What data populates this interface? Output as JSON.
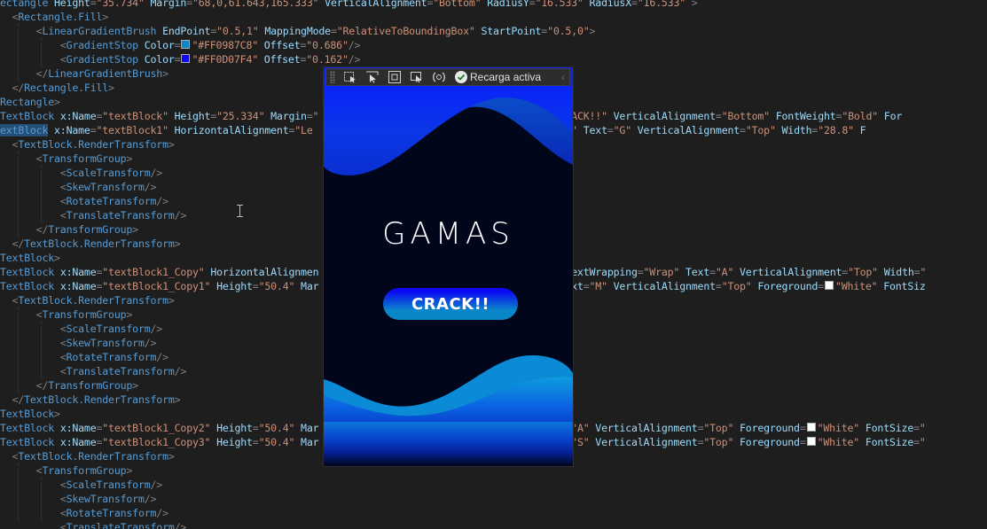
{
  "editor": {
    "lines": [
      [
        [
          "el",
          "ectangle "
        ],
        [
          "at",
          "Height"
        ],
        [
          "br",
          "="
        ],
        [
          "st",
          "\"35.734\""
        ],
        [
          "at",
          " Margin"
        ],
        [
          "br",
          "="
        ],
        [
          "st",
          "\"68,0,61.643,165.333\""
        ],
        [
          "at",
          " VerticalAlignment"
        ],
        [
          "br",
          "="
        ],
        [
          "st",
          "\"Bottom\""
        ],
        [
          "at",
          " RadiusY"
        ],
        [
          "br",
          "="
        ],
        [
          "st",
          "\"16.533\""
        ],
        [
          "at",
          " RadiusX"
        ],
        [
          "br",
          "="
        ],
        [
          "st",
          "\"16.533\""
        ],
        [
          "br",
          " >"
        ]
      ],
      [
        [
          "tx",
          "  "
        ],
        [
          "br",
          "<"
        ],
        [
          "el",
          "Rectangle.Fill"
        ],
        [
          "br",
          ">"
        ]
      ],
      [
        [
          "tx",
          "      "
        ],
        [
          "br",
          "<"
        ],
        [
          "el",
          "LinearGradientBrush"
        ],
        [
          "at",
          " EndPoint"
        ],
        [
          "br",
          "="
        ],
        [
          "st",
          "\"0.5,1\""
        ],
        [
          "at",
          " MappingMode"
        ],
        [
          "br",
          "="
        ],
        [
          "st",
          "\"RelativeToBoundingBox\""
        ],
        [
          "at",
          " StartPoint"
        ],
        [
          "br",
          "="
        ],
        [
          "st",
          "\"0.5,0\""
        ],
        [
          "br",
          ">"
        ]
      ],
      [
        [
          "tx",
          "          "
        ],
        [
          "br",
          "<"
        ],
        [
          "el",
          "GradientStop"
        ],
        [
          "at",
          " Color"
        ],
        [
          "br",
          "="
        ],
        [
          "sw",
          "#0987c8"
        ],
        [
          "st",
          "\"#FF0987C8\""
        ],
        [
          "at",
          " Offset"
        ],
        [
          "br",
          "="
        ],
        [
          "st",
          "\"0.686\""
        ],
        [
          "br",
          "/>"
        ]
      ],
      [
        [
          "tx",
          "          "
        ],
        [
          "br",
          "<"
        ],
        [
          "el",
          "GradientStop"
        ],
        [
          "at",
          " Color"
        ],
        [
          "br",
          "="
        ],
        [
          "sw",
          "#0d07f4"
        ],
        [
          "st",
          "\"#FF0D07F4\""
        ],
        [
          "at",
          " Offset"
        ],
        [
          "br",
          "="
        ],
        [
          "st",
          "\"0.162\""
        ],
        [
          "br",
          "/>"
        ]
      ],
      [
        [
          "tx",
          "      "
        ],
        [
          "br",
          "</"
        ],
        [
          "el",
          "LinearGradientBrush"
        ],
        [
          "br",
          ">"
        ]
      ],
      [
        [
          "tx",
          "  "
        ],
        [
          "br",
          "</"
        ],
        [
          "el",
          "Rectangle.Fill"
        ],
        [
          "br",
          ">"
        ]
      ],
      [
        [
          "el",
          "Rectangle"
        ],
        [
          "br",
          ">"
        ]
      ],
      [
        [
          "el",
          "TextBlock "
        ],
        [
          "at",
          "x:Name"
        ],
        [
          "br",
          "="
        ],
        [
          "st",
          "\"textBlock\""
        ],
        [
          "at",
          " Height"
        ],
        [
          "br",
          "="
        ],
        [
          "st",
          "\"25.334\""
        ],
        [
          "at",
          " Margin"
        ],
        [
          "br",
          "="
        ],
        [
          "st",
          "\""
        ],
        [
          "tx",
          "                              "
        ],
        [
          "st",
          "ap\""
        ],
        [
          "at",
          " Text"
        ],
        [
          "br",
          "="
        ],
        [
          "st",
          "\"CRACK!!\""
        ],
        [
          "at",
          " VerticalAlignment"
        ],
        [
          "br",
          "="
        ],
        [
          "st",
          "\"Bottom\""
        ],
        [
          "at",
          " FontWeight"
        ],
        [
          "br",
          "="
        ],
        [
          "st",
          "\"Bold\""
        ],
        [
          "at",
          " For"
        ]
      ],
      [
        [
          "hl",
          "extBlock"
        ],
        [
          "at",
          " x:Name"
        ],
        [
          "br",
          "="
        ],
        [
          "st",
          "\"textBlock1\""
        ],
        [
          "at",
          " HorizontalAlignment"
        ],
        [
          "br",
          "="
        ],
        [
          "st",
          "\"Le"
        ],
        [
          "tx",
          "                         "
        ],
        [
          "at",
          "TextWrapping"
        ],
        [
          "br",
          "="
        ],
        [
          "st",
          "\"Wrap\""
        ],
        [
          "at",
          " Text"
        ],
        [
          "br",
          "="
        ],
        [
          "st",
          "\"G\""
        ],
        [
          "at",
          " VerticalAlignment"
        ],
        [
          "br",
          "="
        ],
        [
          "st",
          "\"Top\""
        ],
        [
          "at",
          " Width"
        ],
        [
          "br",
          "="
        ],
        [
          "st",
          "\"28.8\""
        ],
        [
          "at",
          " F"
        ]
      ],
      [
        [
          "tx",
          "  "
        ],
        [
          "br",
          "<"
        ],
        [
          "el",
          "TextBlock.RenderTransform"
        ],
        [
          "br",
          ">"
        ]
      ],
      [
        [
          "tx",
          "      "
        ],
        [
          "br",
          "<"
        ],
        [
          "el",
          "TransformGroup"
        ],
        [
          "br",
          ">"
        ]
      ],
      [
        [
          "tx",
          "          "
        ],
        [
          "br",
          "<"
        ],
        [
          "el",
          "ScaleTransform"
        ],
        [
          "br",
          "/>"
        ]
      ],
      [
        [
          "tx",
          "          "
        ],
        [
          "br",
          "<"
        ],
        [
          "el",
          "SkewTransform"
        ],
        [
          "br",
          "/>"
        ]
      ],
      [
        [
          "tx",
          "          "
        ],
        [
          "br",
          "<"
        ],
        [
          "el",
          "RotateTransform"
        ],
        [
          "br",
          "/>"
        ]
      ],
      [
        [
          "tx",
          "          "
        ],
        [
          "br",
          "<"
        ],
        [
          "el",
          "TranslateTransform"
        ],
        [
          "br",
          "/>"
        ]
      ],
      [
        [
          "tx",
          "      "
        ],
        [
          "br",
          "</"
        ],
        [
          "el",
          "TransformGroup"
        ],
        [
          "br",
          ">"
        ]
      ],
      [
        [
          "tx",
          "  "
        ],
        [
          "br",
          "</"
        ],
        [
          "el",
          "TextBlock.RenderTransform"
        ],
        [
          "br",
          ">"
        ]
      ],
      [
        [
          "el",
          "TextBlock"
        ],
        [
          "br",
          ">"
        ]
      ],
      [
        [
          "el",
          "TextBlock "
        ],
        [
          "at",
          "x:Name"
        ],
        [
          "br",
          "="
        ],
        [
          "st",
          "\"textBlock1_Copy\""
        ],
        [
          "at",
          " HorizontalAlignmen"
        ],
        [
          "tx",
          "                                  "
        ],
        [
          "st",
          "4,0,0\""
        ],
        [
          "at",
          " TextWrapping"
        ],
        [
          "br",
          "="
        ],
        [
          "st",
          "\"Wrap\""
        ],
        [
          "at",
          " Text"
        ],
        [
          "br",
          "="
        ],
        [
          "st",
          "\"A\""
        ],
        [
          "at",
          " VerticalAlignment"
        ],
        [
          "br",
          "="
        ],
        [
          "st",
          "\"Top\""
        ],
        [
          "at",
          " Width"
        ],
        [
          "br",
          "="
        ],
        [
          "st",
          "\""
        ]
      ],
      [
        [
          "el",
          "TextBlock "
        ],
        [
          "at",
          "x:Name"
        ],
        [
          "br",
          "="
        ],
        [
          "st",
          "\"textBlock1_Copy1\""
        ],
        [
          "at",
          " Height"
        ],
        [
          "br",
          "="
        ],
        [
          "st",
          "\"50.4\""
        ],
        [
          "at",
          " Mar"
        ],
        [
          "tx",
          "                                  "
        ],
        [
          "st",
          "Wrap\""
        ],
        [
          "at",
          " Text"
        ],
        [
          "br",
          "="
        ],
        [
          "st",
          "\"M\""
        ],
        [
          "at",
          " VerticalAlignment"
        ],
        [
          "br",
          "="
        ],
        [
          "st",
          "\"Top\""
        ],
        [
          "at",
          " Foreground"
        ],
        [
          "br",
          "="
        ],
        [
          "sw",
          "#ffffff"
        ],
        [
          "st",
          "\"White\""
        ],
        [
          "at",
          " FontSiz"
        ]
      ],
      [
        [
          "tx",
          "  "
        ],
        [
          "br",
          "<"
        ],
        [
          "el",
          "TextBlock.RenderTransform"
        ],
        [
          "br",
          ">"
        ]
      ],
      [
        [
          "tx",
          "      "
        ],
        [
          "br",
          "<"
        ],
        [
          "el",
          "TransformGroup"
        ],
        [
          "br",
          ">"
        ]
      ],
      [
        [
          "tx",
          "          "
        ],
        [
          "br",
          "<"
        ],
        [
          "el",
          "ScaleTransform"
        ],
        [
          "br",
          "/>"
        ]
      ],
      [
        [
          "tx",
          "          "
        ],
        [
          "br",
          "<"
        ],
        [
          "el",
          "SkewTransform"
        ],
        [
          "br",
          "/>"
        ]
      ],
      [
        [
          "tx",
          "          "
        ],
        [
          "br",
          "<"
        ],
        [
          "el",
          "RotateTransform"
        ],
        [
          "br",
          "/>"
        ]
      ],
      [
        [
          "tx",
          "          "
        ],
        [
          "br",
          "<"
        ],
        [
          "el",
          "TranslateTransform"
        ],
        [
          "br",
          "/>"
        ]
      ],
      [
        [
          "tx",
          "      "
        ],
        [
          "br",
          "</"
        ],
        [
          "el",
          "TransformGroup"
        ],
        [
          "br",
          ">"
        ]
      ],
      [
        [
          "tx",
          "  "
        ],
        [
          "br",
          "</"
        ],
        [
          "el",
          "TextBlock.RenderTransform"
        ],
        [
          "br",
          ">"
        ]
      ],
      [
        [
          "el",
          "TextBlock"
        ],
        [
          "br",
          ">"
        ]
      ],
      [
        [
          "el",
          "TextBlock "
        ],
        [
          "at",
          "x:Name"
        ],
        [
          "br",
          "="
        ],
        [
          "st",
          "\"textBlock1_Copy2\""
        ],
        [
          "at",
          " Height"
        ],
        [
          "br",
          "="
        ],
        [
          "st",
          "\"50.4\""
        ],
        [
          "at",
          " Mar"
        ],
        [
          "tx",
          "                                  "
        ],
        [
          "st",
          "p\""
        ],
        [
          "at",
          " Text"
        ],
        [
          "br",
          "="
        ],
        [
          "st",
          "\"A\""
        ],
        [
          "at",
          " VerticalAlignment"
        ],
        [
          "br",
          "="
        ],
        [
          "st",
          "\"Top\""
        ],
        [
          "at",
          " Foreground"
        ],
        [
          "br",
          "="
        ],
        [
          "sw",
          "#ffffff"
        ],
        [
          "st",
          "\"White\""
        ],
        [
          "at",
          " FontSize"
        ],
        [
          "br",
          "="
        ],
        [
          "st",
          "\""
        ]
      ],
      [
        [
          "el",
          "TextBlock "
        ],
        [
          "at",
          "x:Name"
        ],
        [
          "br",
          "="
        ],
        [
          "st",
          "\"textBlock1_Copy3\""
        ],
        [
          "at",
          " Height"
        ],
        [
          "br",
          "="
        ],
        [
          "st",
          "\"50.4\""
        ],
        [
          "at",
          " Mar"
        ],
        [
          "tx",
          "                                  "
        ],
        [
          "st",
          "p\""
        ],
        [
          "at",
          " Text"
        ],
        [
          "br",
          "="
        ],
        [
          "st",
          "\"S\""
        ],
        [
          "at",
          " VerticalAlignment"
        ],
        [
          "br",
          "="
        ],
        [
          "st",
          "\"Top\""
        ],
        [
          "at",
          " Foreground"
        ],
        [
          "br",
          "="
        ],
        [
          "sw",
          "#ffffff"
        ],
        [
          "st",
          "\"White\""
        ],
        [
          "at",
          " FontSize"
        ],
        [
          "br",
          "="
        ],
        [
          "st",
          "\""
        ]
      ],
      [
        [
          "tx",
          "  "
        ],
        [
          "br",
          "<"
        ],
        [
          "el",
          "TextBlock.RenderTransform"
        ],
        [
          "br",
          ">"
        ]
      ],
      [
        [
          "tx",
          "      "
        ],
        [
          "br",
          "<"
        ],
        [
          "el",
          "TransformGroup"
        ],
        [
          "br",
          ">"
        ]
      ],
      [
        [
          "tx",
          "          "
        ],
        [
          "br",
          "<"
        ],
        [
          "el",
          "ScaleTransform"
        ],
        [
          "br",
          "/>"
        ]
      ],
      [
        [
          "tx",
          "          "
        ],
        [
          "br",
          "<"
        ],
        [
          "el",
          "SkewTransform"
        ],
        [
          "br",
          "/>"
        ]
      ],
      [
        [
          "tx",
          "          "
        ],
        [
          "br",
          "<"
        ],
        [
          "el",
          "RotateTransform"
        ],
        [
          "br",
          "/>"
        ]
      ],
      [
        [
          "tx",
          "          "
        ],
        [
          "br",
          "<"
        ],
        [
          "el",
          "TranslateTransform"
        ],
        [
          "br",
          "/>"
        ]
      ]
    ]
  },
  "toolbar": {
    "icons": [
      "select-element-icon",
      "pointer-icon",
      "display-adorners-icon",
      "track-focus-icon",
      "binding-failures-icon"
    ],
    "hot_reload_label": "Recarga activa",
    "collapse_glyph": "‹"
  },
  "preview": {
    "title": "GAMAS",
    "button_label": "CRACK!!",
    "colors": {
      "background": "#01061a",
      "wave_dark": "#0d07f4",
      "wave_light": "#0987c8"
    }
  }
}
